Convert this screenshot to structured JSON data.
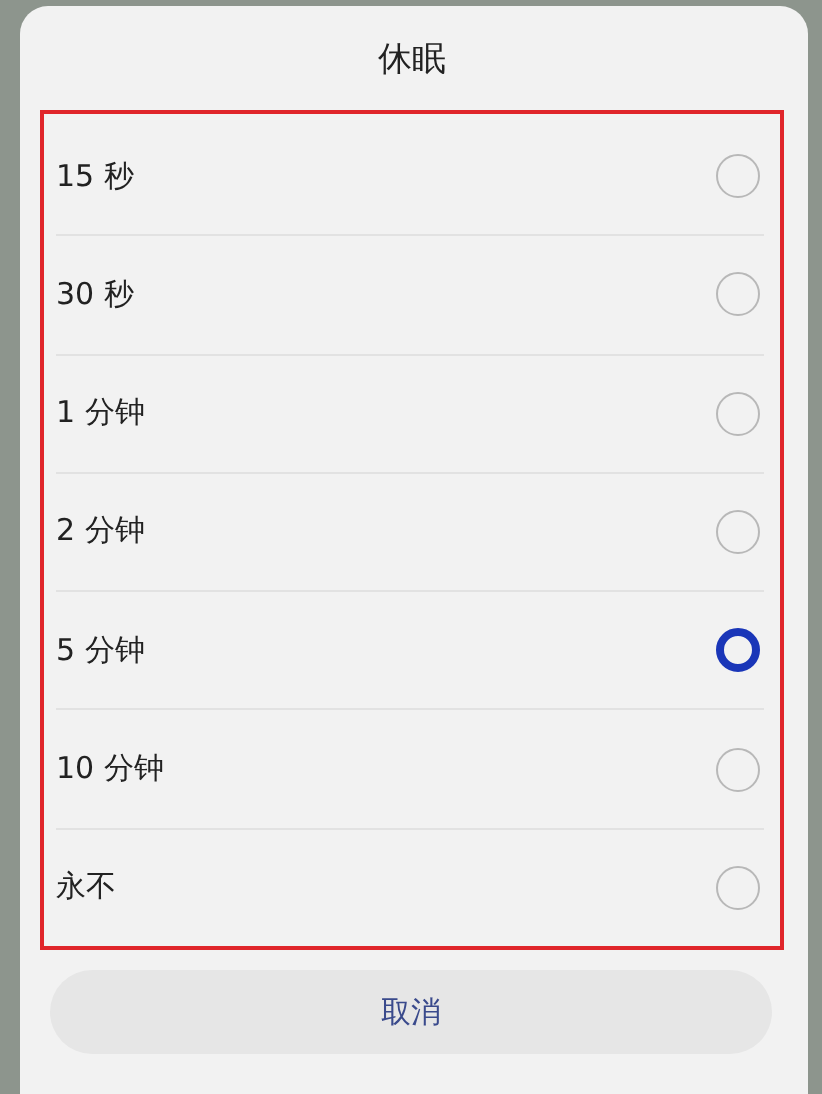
{
  "dialog": {
    "title": "休眠",
    "options": [
      {
        "label": "15 秒",
        "selected": false
      },
      {
        "label": "30 秒",
        "selected": false
      },
      {
        "label": "1 分钟",
        "selected": false
      },
      {
        "label": "2 分钟",
        "selected": false
      },
      {
        "label": "5 分钟",
        "selected": true
      },
      {
        "label": "10 分钟",
        "selected": false
      },
      {
        "label": "永不",
        "selected": false
      }
    ],
    "cancel_button": "取消"
  }
}
